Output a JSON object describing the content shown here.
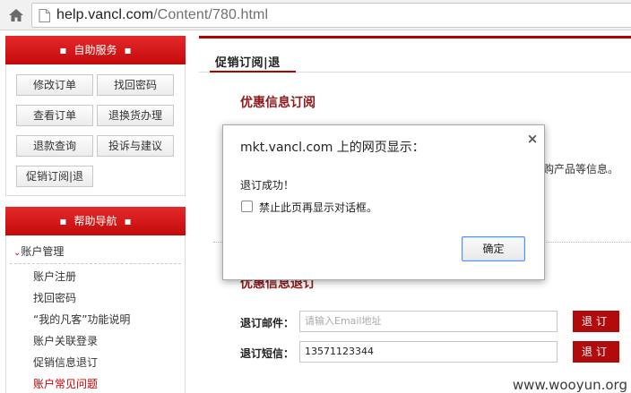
{
  "browser": {
    "url_host": "help.vancl.com",
    "url_path": "/Content/780.html",
    "icons": {
      "home": "home-icon",
      "page": "page-icon"
    }
  },
  "sidebar": {
    "services": {
      "title": "自助服务",
      "buttons": [
        "修改订单",
        "找回密码",
        "查看订单",
        "退换货办理",
        "退款查询",
        "投诉与建议",
        "促销订阅|退"
      ]
    },
    "help_nav": {
      "title": "帮助导航",
      "category": "账户管理",
      "items": [
        "账户注册",
        "找回密码",
        "“我的凡客”功能说明",
        "账户关联登录",
        "促销信息退订",
        "账户常见问题"
      ]
    }
  },
  "main": {
    "page_title": "促销订阅|退",
    "section1_title": "优惠信息订阅",
    "section1_text_tail": "购产品等信息。",
    "section2_title": "优惠信息退订",
    "email_label": "退订邮件：",
    "email_placeholder": "请输入Email地址",
    "sms_label": "退订短信：",
    "sms_value": "13571123344",
    "unsub_label": "退订"
  },
  "dialog": {
    "title": "mkt.vancl.com 上的网页显示：",
    "message": "退订成功！",
    "checkbox_label": "禁止此页再显示对话框。",
    "checkbox_checked": false,
    "ok_label": "确定"
  },
  "watermark": "www.wooyun.org",
  "colors": {
    "brand_red": "#c30a0a",
    "title_red": "#8c1a1a",
    "focus_blue": "#4d90fe"
  }
}
